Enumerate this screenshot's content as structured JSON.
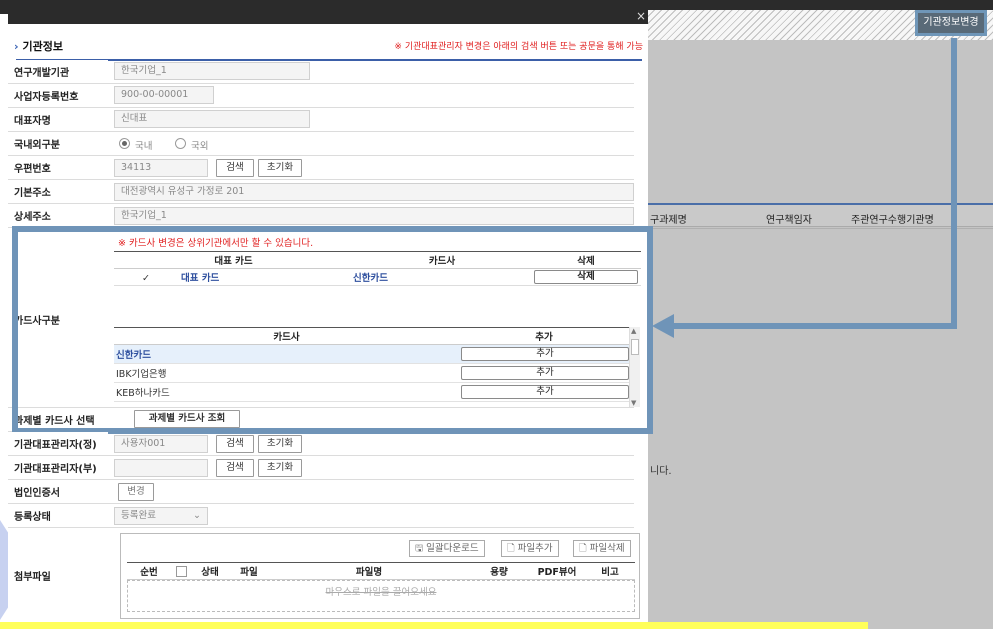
{
  "background": {
    "change_button": "기관정보변경",
    "table_headers": [
      "구과제명",
      "연구책임자",
      "주관연구수행기관명"
    ],
    "note": "니다."
  },
  "modal": {
    "close_glyph": "×",
    "title": "기관정보",
    "notice": "※ 기관대표관리자 변경은 아래의 검색 버튼 또는 공문을 통해 가능",
    "fields": {
      "org_label": "연구개발기관",
      "org_value": "한국기업_1",
      "biz_label": "사업자등록번호",
      "biz_value": "900-00-00001",
      "ceo_label": "대표자명",
      "ceo_value": "신대표",
      "domestic_label": "국내외구분",
      "domestic_opt1": "국내",
      "domestic_opt2": "국외",
      "zip_label": "우편번호",
      "zip_value": "34113",
      "search_btn": "검색",
      "reset_btn": "초기화",
      "addr_label": "기본주소",
      "addr_value": "대전광역시 유성구 가정로 201",
      "detail_label": "상세주소",
      "detail_value": "한국기업_1"
    },
    "card": {
      "label": "카드사구분",
      "notice": "※ 카드사 변경은 상위기관에서만 할 수 있습니다.",
      "selected_headers": [
        "대표 카드",
        "카드사",
        "삭제"
      ],
      "selected_row": {
        "check": "✓",
        "main": "대표 카드",
        "company": "신한카드",
        "action": "삭제"
      },
      "list_headers": [
        "카드사",
        "추가"
      ],
      "list": [
        {
          "name": "신한카드",
          "action": "추가"
        },
        {
          "name": "IBK기업은행",
          "action": "추가"
        },
        {
          "name": "KEB하나카드",
          "action": "추가"
        }
      ]
    },
    "per_task": {
      "label": "과제별 카드사 선택",
      "button": "과제별 카드사 조회"
    },
    "admin_main": {
      "label": "기관대표관리자(정)",
      "value": "사용자001",
      "search_btn": "검색",
      "reset_btn": "초기화"
    },
    "admin_sub": {
      "label": "기관대표관리자(부)",
      "search_btn": "검색",
      "reset_btn": "초기화"
    },
    "cert": {
      "label": "법인인증서",
      "button": "변경"
    },
    "status": {
      "label": "등록상태",
      "value": "등록완료"
    },
    "files": {
      "label": "첨부파일",
      "tools": [
        "일괄다운로드",
        "파일추가",
        "파일삭제"
      ],
      "headers": [
        "순번",
        "",
        "상태",
        "파일",
        "파일명",
        "용량",
        "PDF뷰어",
        "비고"
      ],
      "drop_hint": "마우스로 파일을 끌어오세요"
    }
  }
}
